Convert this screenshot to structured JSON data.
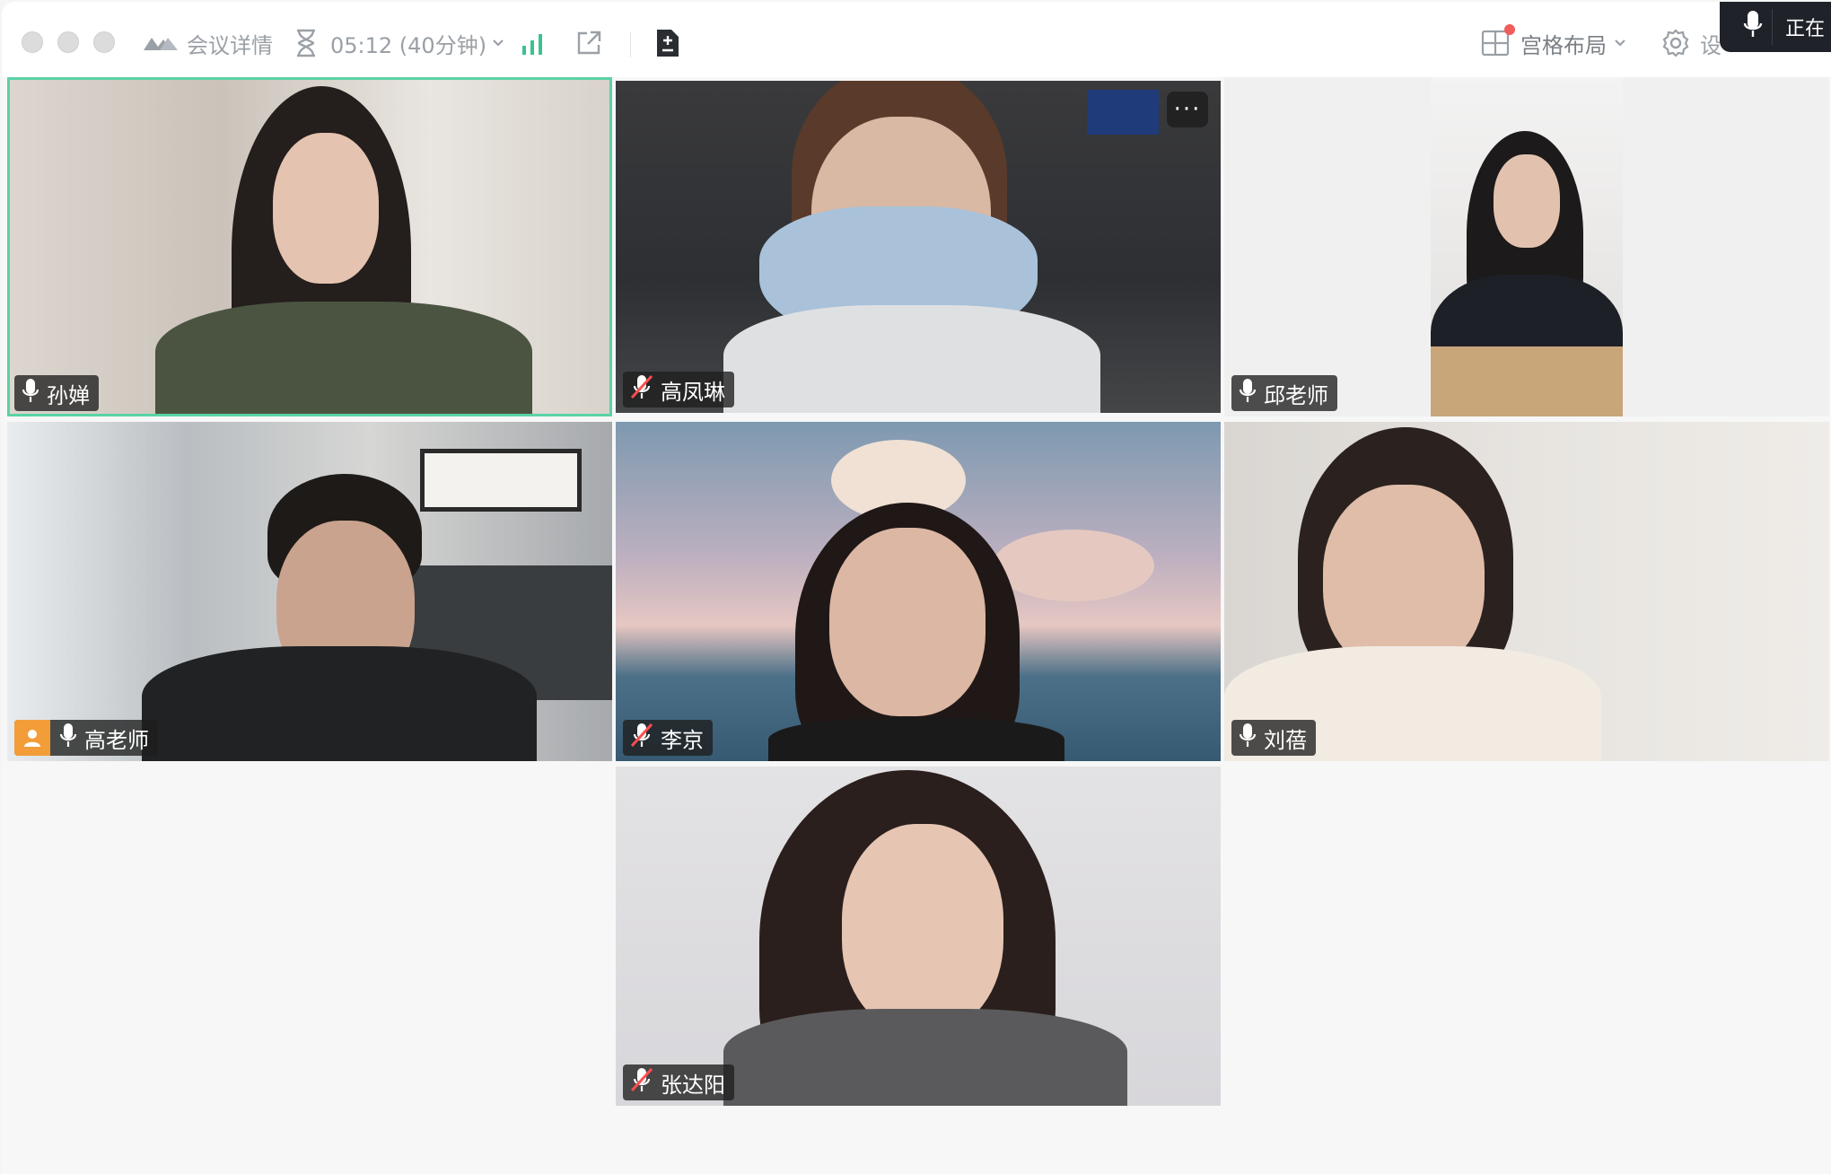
{
  "toolbar": {
    "meeting_details_label": "会议详情",
    "timer_label": "05:12 (40分钟)",
    "layout_label": "宫格布局",
    "settings_label": "设",
    "recording_label": "正在"
  },
  "participants": [
    {
      "name": "孙婵",
      "muted": false,
      "active_speaker": true,
      "host": false
    },
    {
      "name": "高凤琳",
      "muted": true,
      "active_speaker": false,
      "host": false
    },
    {
      "name": "邱老师",
      "muted": false,
      "active_speaker": false,
      "host": false
    },
    {
      "name": "高老师",
      "muted": false,
      "active_speaker": false,
      "host": true
    },
    {
      "name": "李京",
      "muted": true,
      "active_speaker": false,
      "host": false
    },
    {
      "name": "刘蓓",
      "muted": false,
      "active_speaker": false,
      "host": false
    },
    {
      "name": "张达阳",
      "muted": true,
      "active_speaker": false,
      "host": false
    }
  ],
  "more_button_label": "···",
  "colors": {
    "active_border": "#5bd2a5",
    "host_badge": "#f29d38",
    "toolbar_icon": "#9aa0a6",
    "network_bars": "#3dc28f"
  }
}
